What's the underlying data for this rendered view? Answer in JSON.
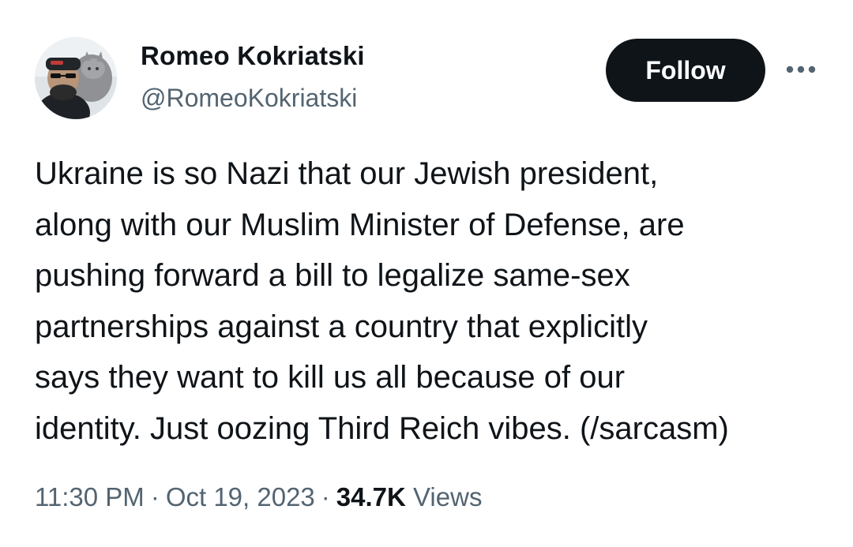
{
  "author": {
    "display_name": "Romeo Kokriatski",
    "handle": "@RomeoKokriatski",
    "avatar_icon": "profile-photo-with-cat"
  },
  "actions": {
    "follow_label": "Follow",
    "more_icon": "ellipsis-icon"
  },
  "tweet": {
    "lines": [
      "Ukraine is so Nazi that our Jewish president,",
      "along with our Muslim Minister of Defense, are",
      "pushing forward a bill to legalize same-sex",
      "partnerships against a country that explicitly",
      "says they want to kill us all because of our",
      "identity. Just oozing Third Reich vibes. (/sarcasm)"
    ]
  },
  "meta": {
    "time": "11:30 PM",
    "separator": "·",
    "date": "Oct 19, 2023",
    "views_count": "34.7K",
    "views_label": "Views"
  },
  "colors": {
    "primary_text": "#0f1419",
    "secondary_text": "#536471",
    "follow_bg": "#0f1419",
    "follow_text": "#ffffff"
  }
}
